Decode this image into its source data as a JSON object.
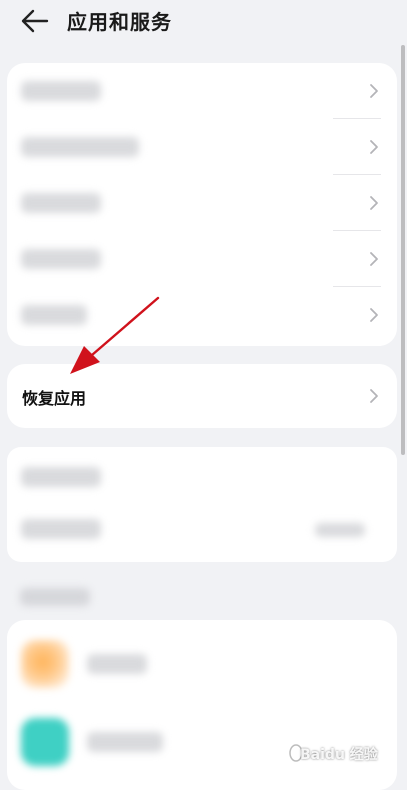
{
  "header": {
    "title": "应用和服务"
  },
  "restore": {
    "label": "恢复应用"
  },
  "colors": {
    "accent_arrow": "#d0121c",
    "card": "#ffffff",
    "background": "#f1f2f5"
  },
  "watermark": {
    "text": "Baidu 经验"
  }
}
